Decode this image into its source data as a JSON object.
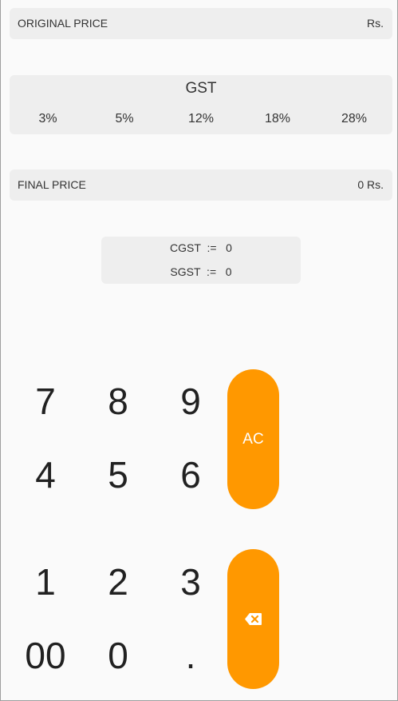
{
  "original_price": {
    "label": "ORIGINAL PRICE",
    "value": "Rs."
  },
  "gst": {
    "title": "GST",
    "options": [
      "3%",
      "5%",
      "12%",
      "18%",
      "28%"
    ]
  },
  "final_price": {
    "label": "FINAL PRICE",
    "value": "0 Rs."
  },
  "tax_breakdown": {
    "cgst": "CGST  :=   0",
    "sgst": "SGST  :=   0"
  },
  "keypad": {
    "keys": [
      "7",
      "8",
      "9",
      "4",
      "5",
      "6",
      "1",
      "2",
      "3",
      "00",
      "0",
      "."
    ],
    "clear_label": "AC",
    "backspace_icon": "backspace-icon"
  },
  "colors": {
    "accent": "#ff9800",
    "card": "#eeeeee",
    "background": "#fafafa"
  }
}
